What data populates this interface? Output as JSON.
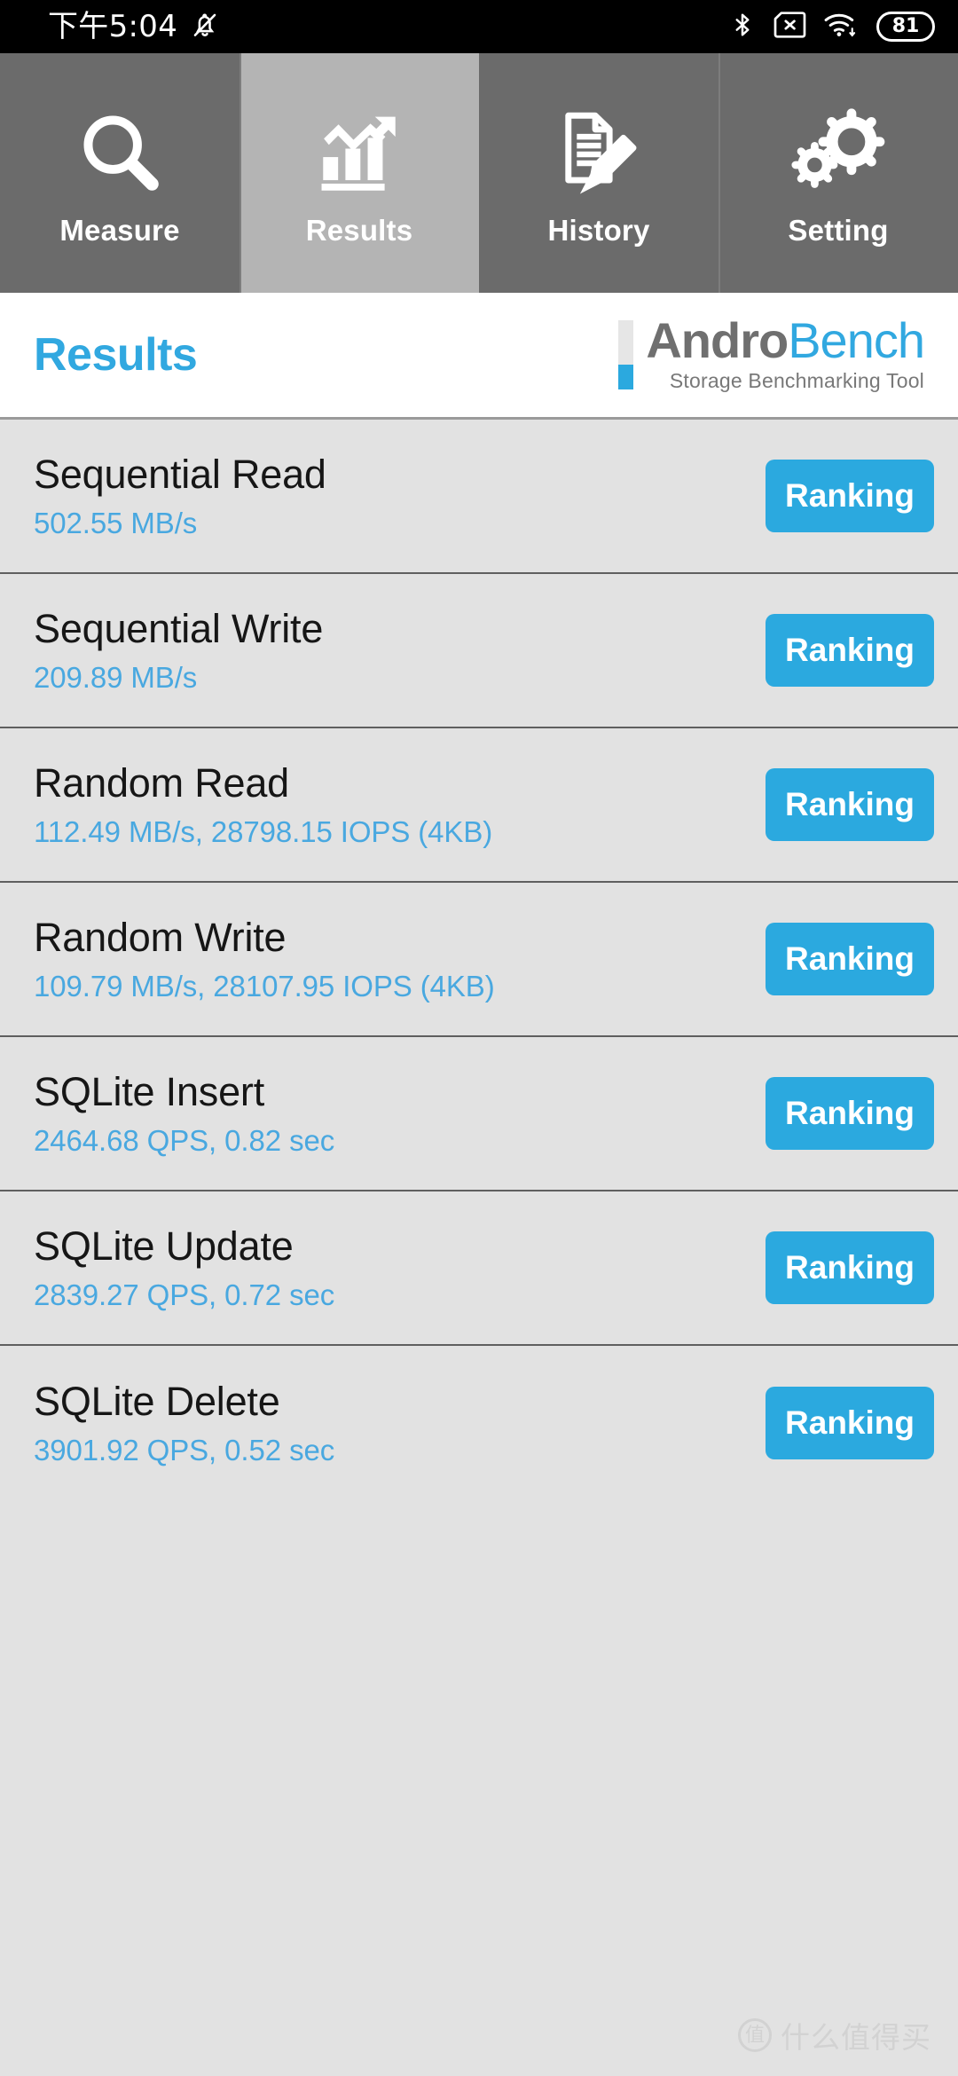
{
  "status_bar": {
    "clock": "下午5:04",
    "left_icons": [
      "bell-mute-icon"
    ],
    "right_icons": [
      "bluetooth-icon",
      "sim-card-off-icon",
      "wifi-icon"
    ],
    "battery_level": "81"
  },
  "tabs": [
    {
      "label": "Measure",
      "icon": "search-icon",
      "selected": false
    },
    {
      "label": "Results",
      "icon": "bar-chart-icon",
      "selected": true
    },
    {
      "label": "History",
      "icon": "document-edit-icon",
      "selected": false
    },
    {
      "label": "Setting",
      "icon": "gears-icon",
      "selected": false
    }
  ],
  "header": {
    "title": "Results",
    "logo_primary": "Andro",
    "logo_secondary": "Bench",
    "logo_tagline": "Storage Benchmarking Tool"
  },
  "results": [
    {
      "name": "Sequential Read",
      "value": "502.55 MB/s",
      "action": "Ranking"
    },
    {
      "name": "Sequential Write",
      "value": "209.89 MB/s",
      "action": "Ranking"
    },
    {
      "name": "Random Read",
      "value": "112.49 MB/s, 28798.15 IOPS (4KB)",
      "action": "Ranking"
    },
    {
      "name": "Random Write",
      "value": "109.79 MB/s, 28107.95 IOPS (4KB)",
      "action": "Ranking"
    },
    {
      "name": "SQLite Insert",
      "value": "2464.68 QPS, 0.82 sec",
      "action": "Ranking"
    },
    {
      "name": "SQLite Update",
      "value": "2839.27 QPS, 0.72 sec",
      "action": "Ranking"
    },
    {
      "name": "SQLite Delete",
      "value": "3901.92 QPS, 0.52 sec",
      "action": "Ranking"
    }
  ],
  "watermark": {
    "badge": "值",
    "text": "什么值得买"
  },
  "colors": {
    "accent_blue": "#2ba9df",
    "value_blue": "#49a8e0",
    "tab_inactive": "#6b6b6b",
    "tab_active": "#b4b4b4",
    "content_bg": "#e2e2e2",
    "status_bar_bg": "#000000"
  }
}
